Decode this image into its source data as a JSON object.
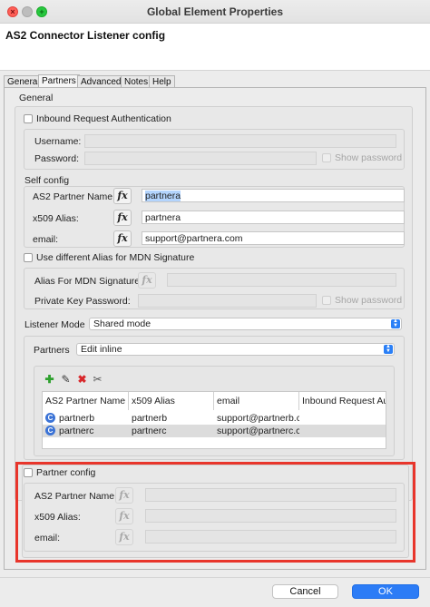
{
  "window": {
    "title": "Global Element Properties"
  },
  "header": {
    "title": "AS2 Connector Listener config"
  },
  "tabs": [
    {
      "label": "General"
    },
    {
      "label": "Partners"
    },
    {
      "label": "Advanced"
    },
    {
      "label": "Notes"
    },
    {
      "label": "Help"
    }
  ],
  "general": {
    "section_label": "General",
    "inbound_auth_label": "Inbound Request Authentication",
    "username_label": "Username:",
    "username_value": "",
    "password_label": "Password:",
    "password_value": "",
    "show_password_label": "Show password"
  },
  "self_config": {
    "section_label": "Self config",
    "partner_name_label": "AS2 Partner Name:",
    "partner_name_value": "partnera",
    "x509_label": "x509 Alias:",
    "x509_value": "partnera",
    "email_label": "email:",
    "email_value": "support@partnera.com",
    "fx_label": "fx"
  },
  "mdn": {
    "use_different_alias_label": "Use different Alias for MDN Signature",
    "alias_label": "Alias For MDN Signature:",
    "alias_value": "",
    "private_key_label": "Private Key Password:",
    "private_key_value": "",
    "show_password_label": "Show password"
  },
  "listener": {
    "mode_label": "Listener Mode",
    "mode_value": "Shared mode",
    "partners_label": "Partners",
    "partners_value": "Edit inline"
  },
  "toolbar": {
    "icons": [
      "add-icon",
      "edit-icon",
      "delete-icon",
      "tools-icon"
    ]
  },
  "table": {
    "headers": [
      "AS2 Partner Name",
      "x509 Alias",
      "email",
      "Inbound Request Auth"
    ],
    "rows": [
      {
        "name": "partnerb",
        "alias": "partnerb",
        "email": "support@partnerb.com"
      },
      {
        "name": "partnerc",
        "alias": "partnerc",
        "email": "support@partnerc.com"
      }
    ],
    "row_icon_glyph": "C"
  },
  "partner_config": {
    "section_label": "Partner config",
    "partner_name_label": "AS2 Partner Name:",
    "x509_label": "x509 Alias:",
    "email_label": "email:",
    "fx_label": "fx"
  },
  "footer": {
    "cancel_label": "Cancel",
    "ok_label": "OK"
  },
  "colors": {
    "accent": "#2c7cf6",
    "highlight_border": "#e8352b",
    "selection": "#b3d4fd"
  }
}
